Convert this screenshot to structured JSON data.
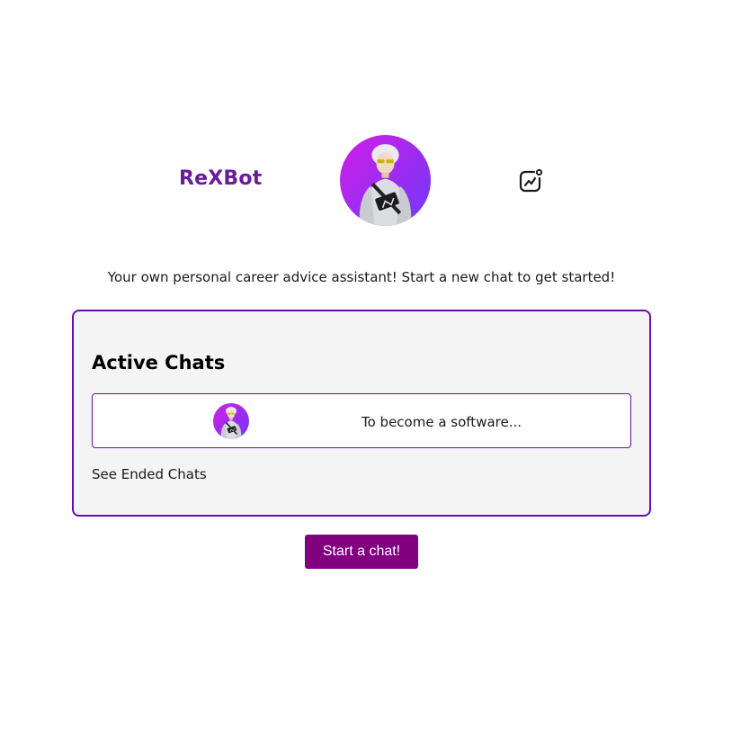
{
  "header": {
    "app_title": "ReXBot",
    "avatar_icon": "bot-avatar-icon",
    "insights_icon": "chart-insights-icon"
  },
  "tagline": "Your own personal career advice assistant! Start a new chat to get started!",
  "active_chats": {
    "heading": "Active Chats",
    "items": [
      {
        "preview": "To become a software...",
        "avatar_icon": "bot-avatar-icon"
      }
    ],
    "see_ended_label": "See Ended Chats"
  },
  "start_chat_label": "Start a chat!",
  "colors": {
    "brand_purple": "#6a1b9a",
    "card_border": "#6a0dad",
    "button_bg": "#800080",
    "card_bg": "#f4f4f5"
  }
}
